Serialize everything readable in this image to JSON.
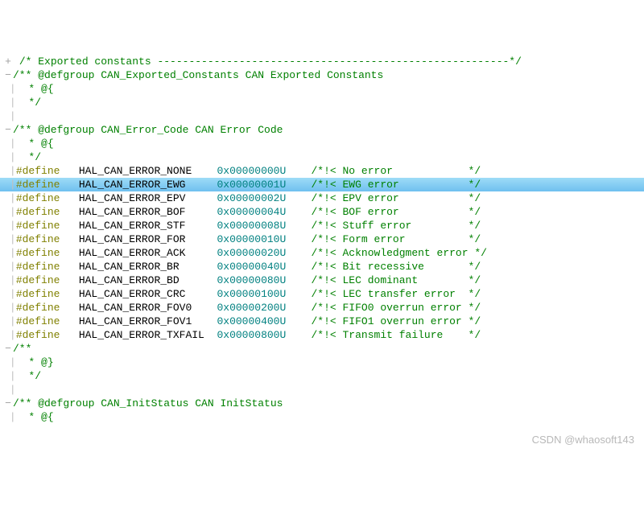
{
  "header1": "/* Exported constants --------------------------------------------------------*/",
  "g1_open": "/** @defgroup CAN_Exported_Constants CAN Exported Constants",
  "g_open_brace": "  * @{",
  "g_close_cmt": "  */",
  "g2_open": "/** @defgroup CAN_Error_Code CAN Error Code",
  "g3_open": "/** @defgroup CAN_InitStatus CAN InitStatus",
  "defines": [
    {
      "name": "HAL_CAN_ERROR_NONE",
      "val": "0x00000000U",
      "desc": "/*!< No error"
    },
    {
      "name": "HAL_CAN_ERROR_EWG",
      "val": "0x00000001U",
      "desc": "/*!< EWG error"
    },
    {
      "name": "HAL_CAN_ERROR_EPV",
      "val": "0x00000002U",
      "desc": "/*!< EPV error"
    },
    {
      "name": "HAL_CAN_ERROR_BOF",
      "val": "0x00000004U",
      "desc": "/*!< BOF error"
    },
    {
      "name": "HAL_CAN_ERROR_STF",
      "val": "0x00000008U",
      "desc": "/*!< Stuff error"
    },
    {
      "name": "HAL_CAN_ERROR_FOR",
      "val": "0x00000010U",
      "desc": "/*!< Form error"
    },
    {
      "name": "HAL_CAN_ERROR_ACK",
      "val": "0x00000020U",
      "desc": "/*!< Acknowledgment error"
    },
    {
      "name": "HAL_CAN_ERROR_BR",
      "val": "0x00000040U",
      "desc": "/*!< Bit recessive"
    },
    {
      "name": "HAL_CAN_ERROR_BD",
      "val": "0x00000080U",
      "desc": "/*!< LEC dominant"
    },
    {
      "name": "HAL_CAN_ERROR_CRC",
      "val": "0x00000100U",
      "desc": "/*!< LEC transfer error"
    },
    {
      "name": "HAL_CAN_ERROR_FOV0",
      "val": "0x00000200U",
      "desc": "/*!< FIFO0 overrun error"
    },
    {
      "name": "HAL_CAN_ERROR_FOV1",
      "val": "0x00000400U",
      "desc": "/*!< FIFO1 overrun error"
    },
    {
      "name": "HAL_CAN_ERROR_TXFAIL",
      "val": "0x00000800U",
      "desc": "/*!< Transmit failure"
    }
  ],
  "selected_index": 1,
  "close_group_open": "/**",
  "close_group_brace": "  * @}",
  "def_kw": "#define",
  "end_cmt": "*/",
  "watermark": "CSDN @whaosoft143",
  "fold_plus": "+",
  "fold_minus": "−",
  "name_col": 22,
  "val_col": 15,
  "desc_col": 24
}
